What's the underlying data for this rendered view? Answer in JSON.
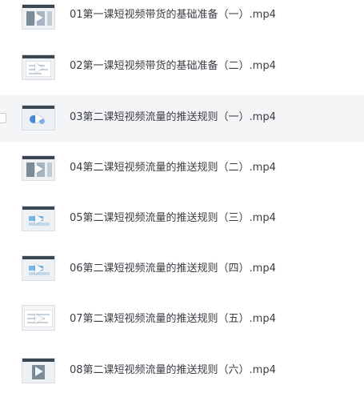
{
  "files": [
    {
      "name": "01第一课短视频带货的基础准备（一）.mp4",
      "thumb_icon": "video-thumbnail-icon"
    },
    {
      "name": "02第一课短视频带货的基础准备（二）.mp4",
      "thumb_icon": "video-thumbnail-icon"
    },
    {
      "name": "03第二课短视频流量的推送规则（一）.mp4",
      "thumb_icon": "video-thumbnail-icon"
    },
    {
      "name": "04第二课短视频流量的推送规则（二）.mp4",
      "thumb_icon": "video-thumbnail-icon"
    },
    {
      "name": "05第二课短视频流量的推送规则（三）.mp4",
      "thumb_icon": "video-thumbnail-icon"
    },
    {
      "name": "06第二课短视频流量的推送规则（四）.mp4",
      "thumb_icon": "video-thumbnail-icon"
    },
    {
      "name": "07第二课短视频流量的推送规则（五）.mp4",
      "thumb_icon": "video-thumbnail-icon"
    },
    {
      "name": "08第二课短视频流量的推送规则（六）.mp4",
      "thumb_icon": "video-thumbnail-icon"
    }
  ],
  "colors": {
    "hover_row_background": "#f4f5f7",
    "text": "#3a3d43"
  }
}
